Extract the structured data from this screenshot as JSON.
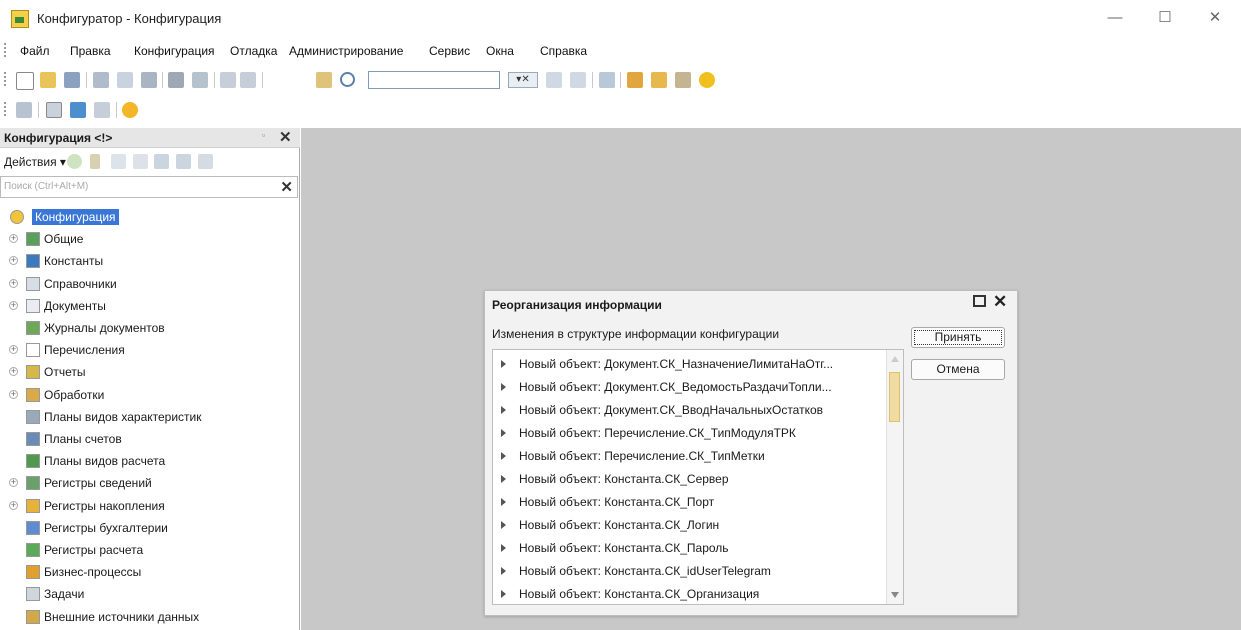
{
  "window": {
    "title": "Конфигуратор - Конфигурация",
    "minimize": "—",
    "maximize": "☐",
    "close": "✕"
  },
  "menu": [
    "Файл",
    "Правка",
    "Конфигурация",
    "Отладка",
    "Администрирование",
    "Сервис",
    "Окна",
    "Справка"
  ],
  "toolbar": {
    "search_value": "",
    "combo_label": "▾✕"
  },
  "panel": {
    "title": "Конфигурация <!>",
    "pin": "▫",
    "close": "✕",
    "actions_label": "Действия ▾",
    "search_placeholder": "Поиск (Ctrl+Alt+M)",
    "search_clear": "✕",
    "tree": [
      {
        "label": "Конфигурация",
        "icon": "config-icon",
        "expander": false,
        "selected": true
      },
      {
        "label": "Общие",
        "icon": "common-icon",
        "expander": true
      },
      {
        "label": "Константы",
        "icon": "constants-icon",
        "expander": true
      },
      {
        "label": "Справочники",
        "icon": "catalogs-icon",
        "expander": true
      },
      {
        "label": "Документы",
        "icon": "documents-icon",
        "expander": true
      },
      {
        "label": "Журналы документов",
        "icon": "journals-icon",
        "expander": false
      },
      {
        "label": "Перечисления",
        "icon": "enums-icon",
        "expander": true
      },
      {
        "label": "Отчеты",
        "icon": "reports-icon",
        "expander": true
      },
      {
        "label": "Обработки",
        "icon": "processing-icon",
        "expander": true
      },
      {
        "label": "Планы видов характеристик",
        "icon": "char-plans-icon",
        "expander": false
      },
      {
        "label": "Планы счетов",
        "icon": "accounts-icon",
        "expander": false
      },
      {
        "label": "Планы видов расчета",
        "icon": "calc-plans-icon",
        "expander": false
      },
      {
        "label": "Регистры сведений",
        "icon": "info-registers-icon",
        "expander": true
      },
      {
        "label": "Регистры накопления",
        "icon": "accum-registers-icon",
        "expander": true
      },
      {
        "label": "Регистры бухгалтерии",
        "icon": "acc-registers-icon",
        "expander": false
      },
      {
        "label": "Регистры расчета",
        "icon": "calc-registers-icon",
        "expander": false
      },
      {
        "label": "Бизнес-процессы",
        "icon": "business-process-icon",
        "expander": false
      },
      {
        "label": "Задачи",
        "icon": "tasks-icon",
        "expander": false
      },
      {
        "label": "Внешние источники данных",
        "icon": "external-sources-icon",
        "expander": false
      }
    ]
  },
  "dialog": {
    "title": "Реорганизация информации",
    "subtitle": "Изменения в структуре информации конфигурации",
    "accept": "Принять",
    "cancel": "Отмена",
    "rows": [
      "Новый объект: Документ.СК_НазначениеЛимитаНаОтг...",
      "Новый объект: Документ.СК_ВедомостьРаздачиТопли...",
      "Новый объект: Документ.СК_ВводНачальныхОстатков",
      "Новый объект: Перечисление.СК_ТипМодуляТРК",
      "Новый объект: Перечисление.СК_ТипМетки",
      "Новый объект: Константа.СК_Сервер",
      "Новый объект: Константа.СК_Порт",
      "Новый объект: Константа.СК_Логин",
      "Новый объект: Константа.СК_Пароль",
      "Новый объект: Константа.СК_idUserTelegram",
      "Новый объект: Константа.СК_Организация"
    ]
  }
}
